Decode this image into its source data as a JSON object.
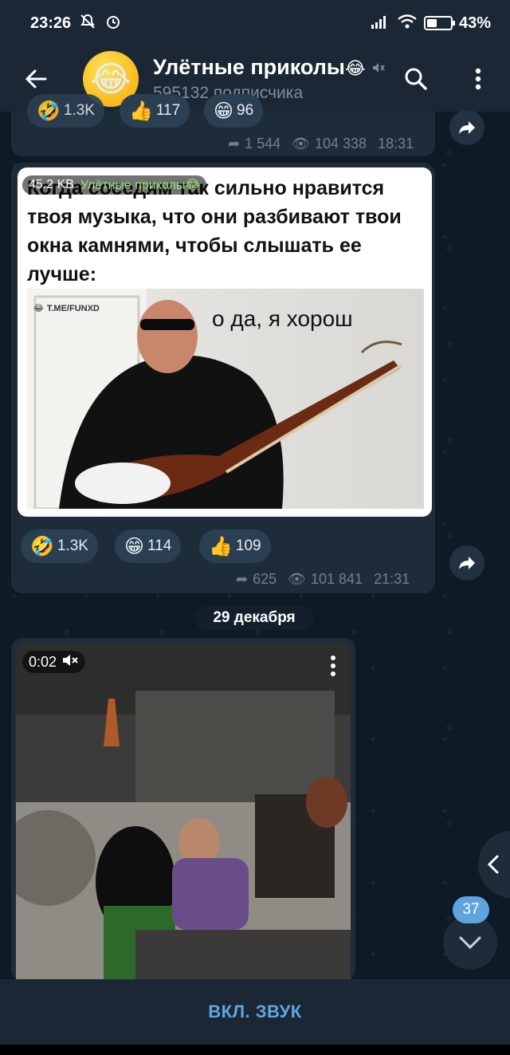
{
  "status_bar": {
    "time": "23:26",
    "battery": "43%"
  },
  "header": {
    "channel_title": "Улётные приколы",
    "subscribers": "595132 подписчика",
    "avatar_emoji": "😂",
    "title_emoji": "😂",
    "muted_icon": "muted-speaker-icon"
  },
  "message_top": {
    "reactions_partial": [
      "1.3K",
      "117",
      "96"
    ],
    "forwards": "1 544",
    "views": "104 338",
    "time": "18:31"
  },
  "message_meme": {
    "file_size": "45.2 KB",
    "badge_channel": "Улётные приколы😂",
    "text": "Когда соседям так сильно нравится твоя музыка, что они разбивают твои окна камнями, чтобы слышать ее лучше:",
    "watermark": "T.ME/FUNXD",
    "overlay_caption": "о да, я хорош",
    "reactions": [
      {
        "emoji": "🤣",
        "count": "1.3K"
      },
      {
        "emoji": "😁",
        "count": "114"
      },
      {
        "emoji": "👍",
        "count": "109"
      }
    ],
    "forwards": "625",
    "views": "101 841",
    "time": "21:31"
  },
  "date_separator": "29 декабря",
  "message_video": {
    "duration": "0:02"
  },
  "scroll": {
    "unread_count": "37"
  },
  "bottom": {
    "unmute_label": "ВКЛ. ЗВУК"
  }
}
